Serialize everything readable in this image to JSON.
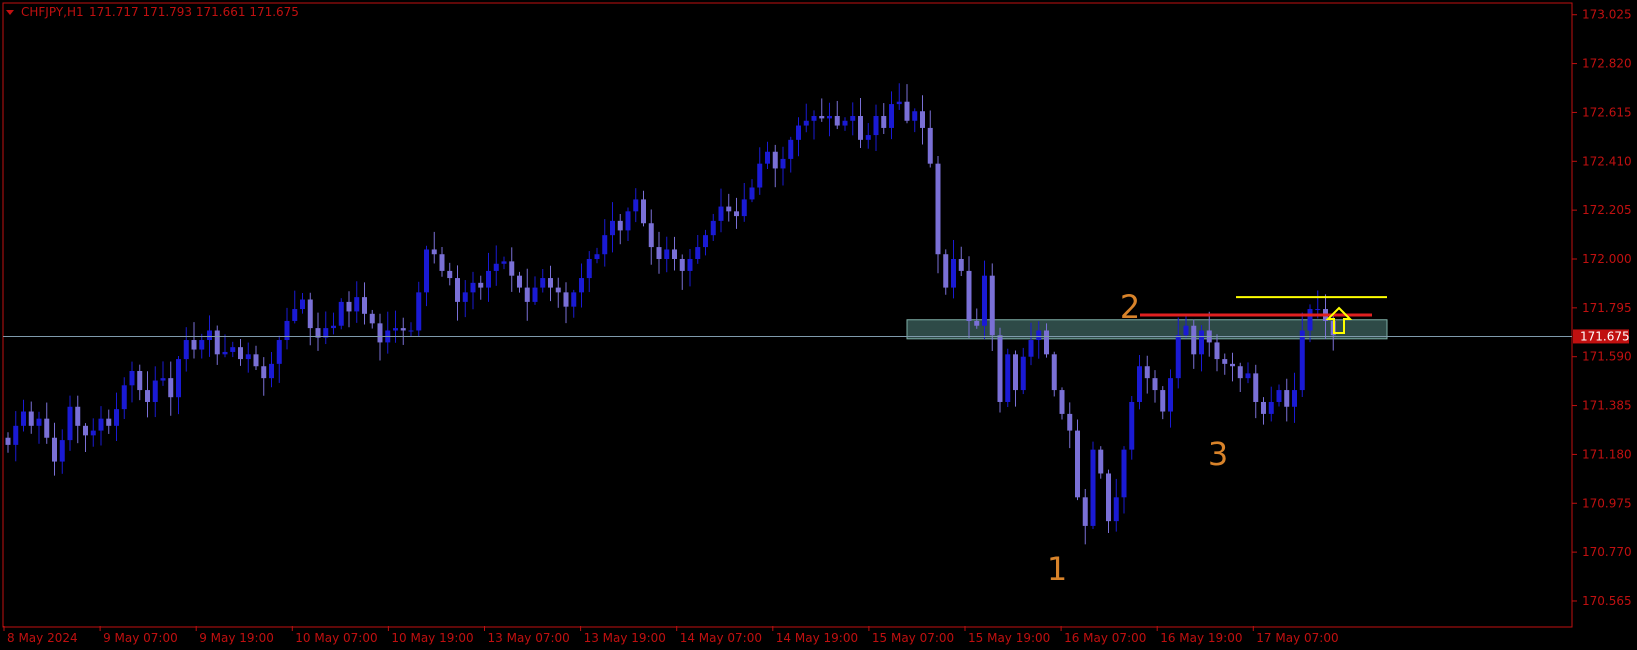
{
  "header": {
    "symbol_timeframe": "CHFJPY,H1",
    "ohlc": "171.717 171.793 171.661 171.675"
  },
  "colors": {
    "background": "#000000",
    "frame": "#c01010",
    "axis_text": "#c01010",
    "bull_candle": "#1a1ad4",
    "bear_candle": "#7a70d6",
    "price_line": "#7f9aab",
    "price_tag_bg": "#c01010",
    "zone_fill": "#2e4a47",
    "zone_border": "#7fb0a8",
    "red_line": "#e02020",
    "yellow_line": "#ffff00",
    "annotation_text": "#d8832a"
  },
  "chart_data": {
    "type": "candlestick",
    "symbol": "CHFJPY",
    "timeframe": "H1",
    "y_axis": {
      "range": [
        170.46,
        173.07
      ],
      "ticks": [
        "173.025",
        "172.820",
        "172.615",
        "172.410",
        "172.205",
        "172.000",
        "171.795",
        "171.590",
        "171.385",
        "171.180",
        "170.975",
        "170.770",
        "170.565"
      ]
    },
    "x_axis": {
      "ticks": [
        "8 May 2024",
        "9 May 07:00",
        "9 May 19:00",
        "10 May 07:00",
        "10 May 19:00",
        "13 May 07:00",
        "13 May 19:00",
        "14 May 07:00",
        "14 May 19:00",
        "15 May 07:00",
        "15 May 19:00",
        "16 May 07:00",
        "16 May 19:00",
        "17 May 07:00"
      ]
    },
    "current_price": "171.675",
    "support_zone": {
      "low": 171.665,
      "high": 171.745
    },
    "red_level": 171.765,
    "yellow_level": 171.84,
    "annotations": [
      {
        "label": "1",
        "kind": "low point"
      },
      {
        "label": "2",
        "kind": "high point"
      },
      {
        "label": "3",
        "kind": "higher low"
      }
    ],
    "arrow": "up",
    "close_path": [
      171.22,
      171.3,
      171.36,
      171.3,
      171.33,
      171.25,
      171.15,
      171.24,
      171.38,
      171.3,
      171.26,
      171.28,
      171.33,
      171.3,
      171.37,
      171.47,
      171.53,
      171.45,
      171.4,
      171.49,
      171.5,
      171.42,
      171.58,
      171.66,
      171.62,
      171.66,
      171.7,
      171.6,
      171.61,
      171.63,
      171.58,
      171.6,
      171.55,
      171.5,
      171.56,
      171.66,
      171.74,
      171.79,
      171.83,
      171.71,
      171.67,
      171.71,
      171.72,
      171.82,
      171.78,
      171.84,
      171.77,
      171.73,
      171.65,
      171.7,
      171.71,
      171.7,
      171.7,
      171.86,
      172.04,
      172.02,
      171.95,
      171.92,
      171.82,
      171.86,
      171.9,
      171.88,
      171.95,
      171.98,
      171.99,
      171.93,
      171.88,
      171.82,
      171.88,
      171.92,
      171.88,
      171.86,
      171.8,
      171.86,
      171.92,
      172.0,
      172.02,
      172.1,
      172.16,
      172.12,
      172.2,
      172.25,
      172.15,
      172.05,
      172.0,
      172.04,
      172.0,
      171.95,
      172.0,
      172.05,
      172.1,
      172.16,
      172.22,
      172.2,
      172.18,
      172.25,
      172.3,
      172.4,
      172.45,
      172.38,
      172.42,
      172.5,
      172.56,
      172.58,
      172.6,
      172.59,
      172.6,
      172.56,
      172.58,
      172.6,
      172.5,
      172.52,
      172.6,
      172.55,
      172.65,
      172.66,
      172.58,
      172.62,
      172.55,
      172.4,
      172.02,
      171.88,
      172.0,
      171.95,
      171.74,
      171.72,
      171.93,
      171.68,
      171.4,
      171.6,
      171.45,
      171.59,
      171.66,
      171.7,
      171.6,
      171.45,
      171.35,
      171.28,
      171.0,
      170.88,
      171.2,
      171.1,
      170.9,
      171.0,
      171.2,
      171.4,
      171.55,
      171.5,
      171.45,
      171.36,
      171.5,
      171.68,
      171.72,
      171.6,
      171.7,
      171.65,
      171.58,
      171.56,
      171.55,
      171.5,
      171.52,
      171.4,
      171.35,
      171.4,
      171.45,
      171.38,
      171.45,
      171.7,
      171.79,
      171.79,
      171.74,
      171.68
    ]
  }
}
